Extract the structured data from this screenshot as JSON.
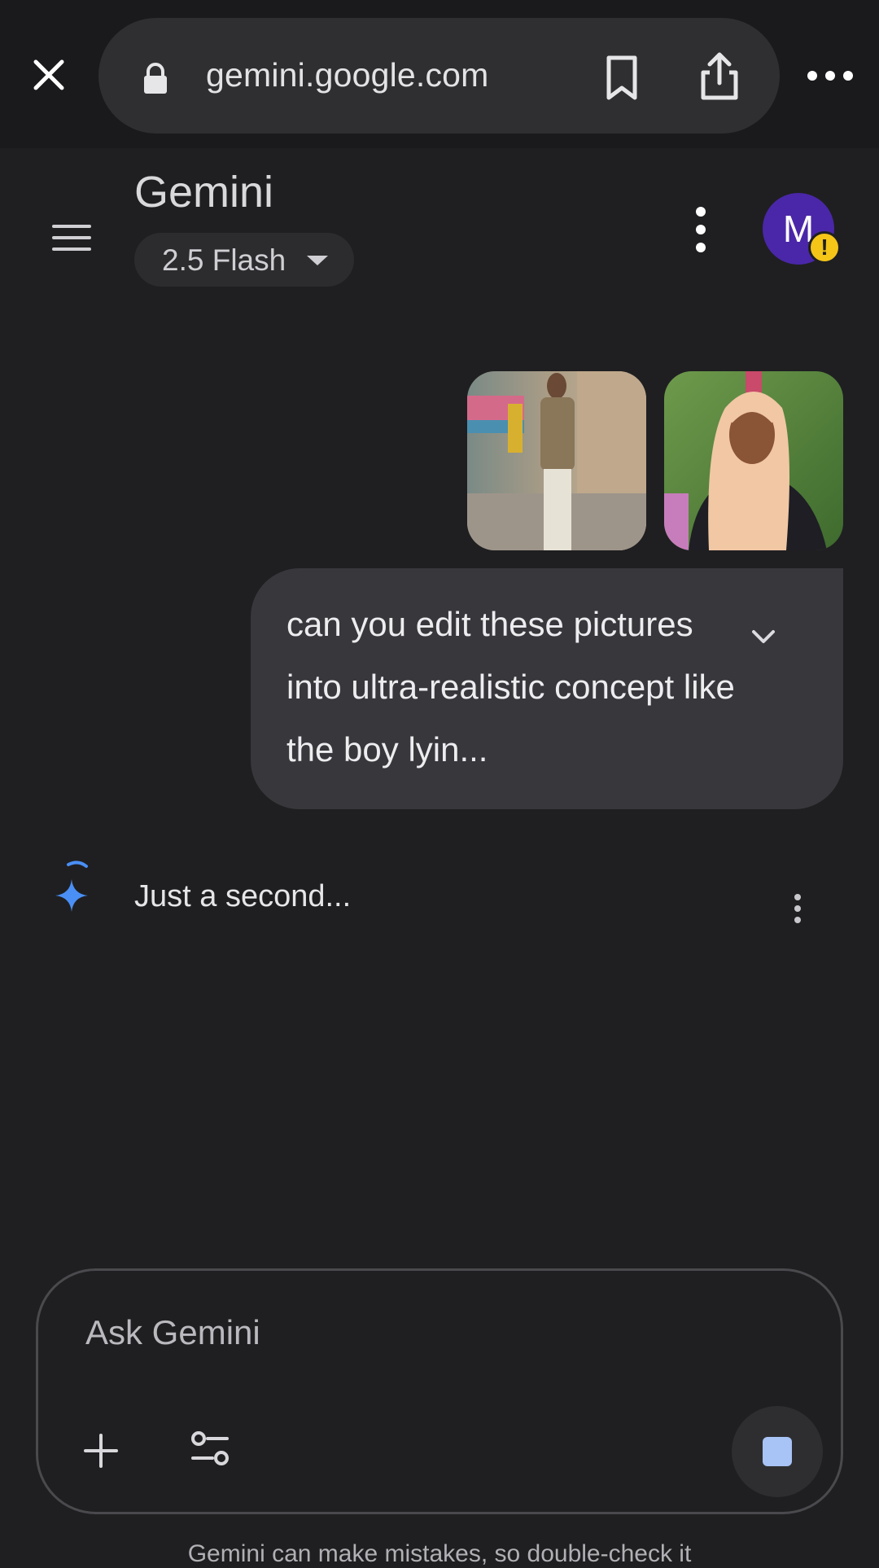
{
  "browser": {
    "url": "gemini.google.com",
    "icons": [
      "close-icon",
      "lock-icon",
      "bookmark-icon",
      "share-icon",
      "more-horizontal-icon"
    ]
  },
  "header": {
    "title": "Gemini",
    "model": "2.5 Flash",
    "avatar_initial": "M",
    "avatar_badge": "!",
    "colors": {
      "avatar": "#4a27a8",
      "badge": "#f5c518"
    }
  },
  "conversation": {
    "attachments": [
      "image-1",
      "image-2"
    ],
    "user_message": "can you edit these pictures into ultra-realistic concept like the boy lyin...",
    "response_status": "Just a second..."
  },
  "composer": {
    "placeholder": "Ask Gemini",
    "stop_color": "#a8c3f5"
  },
  "footer": {
    "disclaimer": "Gemini can make mistakes, so double-check it"
  }
}
